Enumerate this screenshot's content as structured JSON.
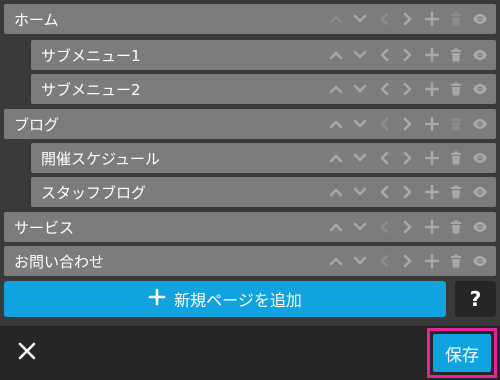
{
  "menu": {
    "items": [
      {
        "label": "ホーム",
        "level": 0
      },
      {
        "label": "サブメニュー1",
        "level": 1
      },
      {
        "label": "サブメニュー2",
        "level": 1
      },
      {
        "label": "ブログ",
        "level": 0
      },
      {
        "label": "開催スケジュール",
        "level": 1
      },
      {
        "label": "スタッフブログ",
        "level": 1
      },
      {
        "label": "サービス",
        "level": 0
      },
      {
        "label": "お問い合わせ",
        "level": 0
      }
    ],
    "item_controls": [
      "move-up-icon",
      "move-down-icon",
      "outdent-icon",
      "indent-icon",
      "add-icon",
      "trash-icon",
      "eye-icon"
    ]
  },
  "actions": {
    "add_page_label": "新規ページを追加",
    "help_label": "?",
    "save_label": "保存"
  },
  "colors": {
    "background": "#3a3a3a",
    "row": "#7c7c7c",
    "accent": "#11a3df",
    "footer": "#262626",
    "highlight": "#e2259a"
  }
}
